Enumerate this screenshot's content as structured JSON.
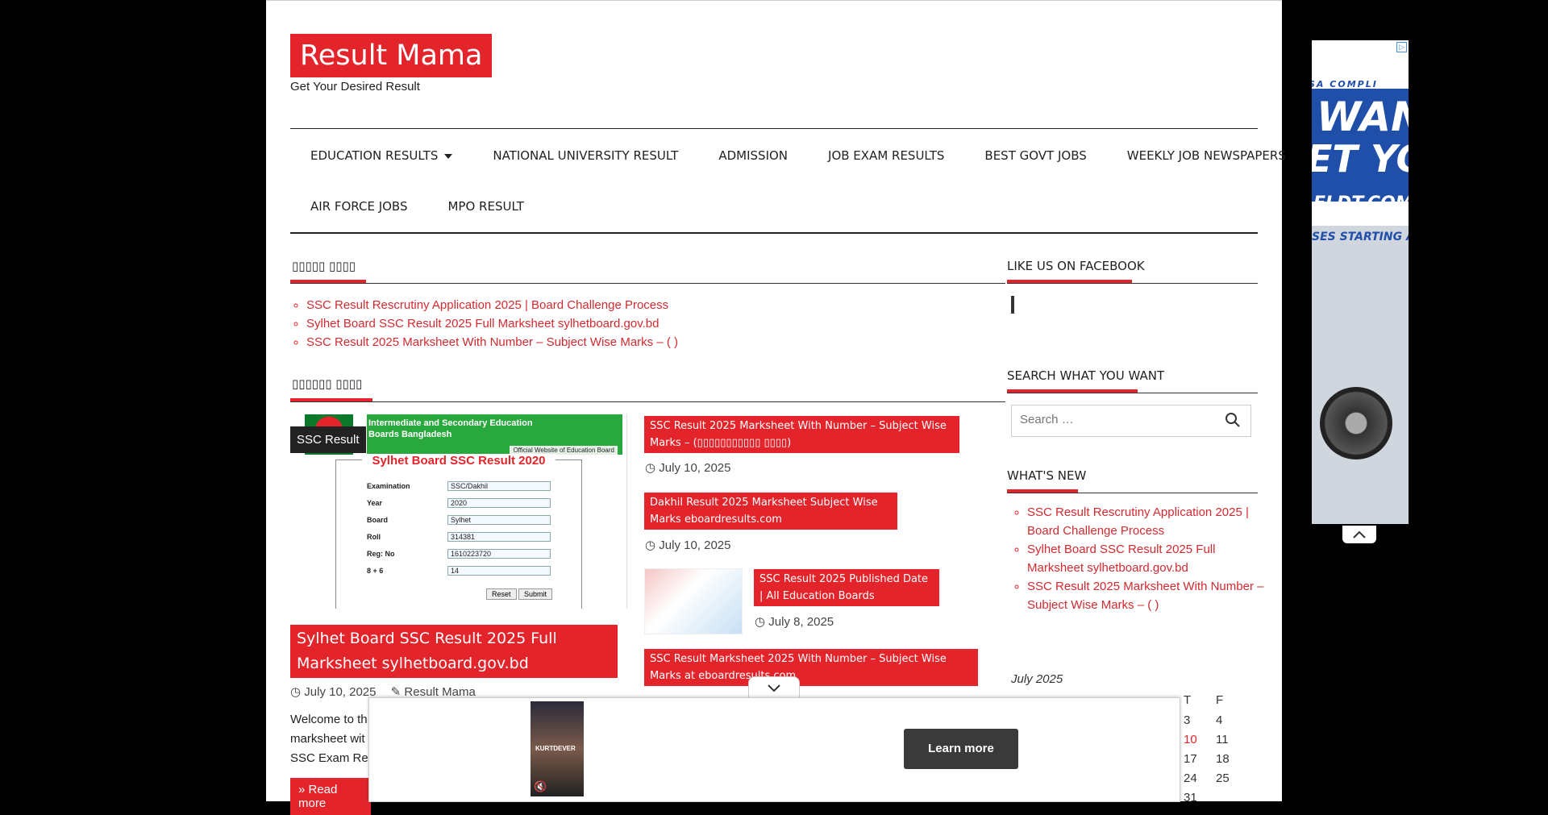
{
  "site": {
    "title": "Result Mama",
    "tagline": "Get Your Desired Result"
  },
  "nav": {
    "row1": [
      "EDUCATION RESULTS",
      "NATIONAL UNIVERSITY RESULT",
      "ADMISSION",
      "JOB EXAM RESULTS",
      "BEST GOVT JOBS",
      "WEEKLY JOB NEWSPAPERS"
    ],
    "row2": [
      "AIR FORCE JOBS",
      "MPO RESULT"
    ]
  },
  "latest": {
    "title": "▯▯▯▯▯ ▯▯▯▯",
    "items": [
      "SSC Result Rescrutiny Application 2025 | Board Challenge Process",
      "Sylhet Board SSC Result 2025 Full Marksheet sylhetboard.gov.bd",
      "SSC Result 2025 Marksheet With Number – Subject Wise Marks – (                    )"
    ]
  },
  "featured_section": {
    "title": "▯▯▯▯▯▯ ▯▯▯▯",
    "category": "SSC Result",
    "image": {
      "header": "Intermediate and Secondary Education Boards Bangladesh",
      "subheader": "Official Website of Education Board",
      "form_title": "Sylhet Board SSC Result 2020",
      "rows": [
        {
          "label": "Examination",
          "value": "SSC/Dakhil"
        },
        {
          "label": "Year",
          "value": "2020"
        },
        {
          "label": "Board",
          "value": "Sylhet"
        },
        {
          "label": "Roll",
          "value": "314381"
        },
        {
          "label": "Reg: No",
          "value": "1610223720"
        },
        {
          "label": "8 + 6",
          "value": "14"
        }
      ],
      "reset": "Reset",
      "submit": "Submit"
    },
    "post_title": "Sylhet Board SSC Result 2025 Full Marksheet sylhetboard.gov.bd",
    "date": "July 10, 2025",
    "author": "Result Mama",
    "excerpt": "Welcome to th marksheet wit SSC Exam Res",
    "read_more": "» Read more"
  },
  "side_posts": [
    {
      "title": "SSC Result 2025 Marksheet With Number – Subject Wise Marks – (▯▯▯▯▯▯▯▯▯▯▯ ▯▯▯▯)",
      "date": "July 10, 2025"
    },
    {
      "title": "Dakhil Result 2025 Marksheet Subject Wise Marks eboardresults.com",
      "date": "July 10, 2025"
    },
    {
      "title": "SSC Result 2025 Published Date | All Education Boards",
      "date": "July 8, 2025"
    },
    {
      "title": "SSC Result Marksheet 2025 With Number – Subject Wise Marks at eboardresults.com",
      "date": ""
    }
  ],
  "sidebar": {
    "facebook_title": "LIKE US ON FACEBOOK",
    "search_title": "SEARCH WHAT YOU WANT",
    "search_placeholder": "Search …",
    "whats_new_title": "WHAT'S NEW",
    "whats_new": [
      "SSC Result Rescrutiny Application 2025 | Board Challenge Process",
      "Sylhet Board SSC Result 2025 Full Marksheet sylhetboard.gov.bd",
      "SSC Result 2025 Marksheet With Number – Subject Wise Marks – (            )"
    ],
    "calendar": {
      "caption": "July 2025",
      "headers": [
        "T",
        "F"
      ],
      "rows": [
        [
          "3",
          "4"
        ],
        [
          "10",
          "11"
        ],
        [
          "17",
          "18"
        ],
        [
          "24",
          "25"
        ],
        [
          "31",
          ""
        ]
      ]
    }
  },
  "right_ad": {
    "line1": "SA COMPLI",
    "line2": "WANT",
    "line3": "ET YOUR",
    "line4": "ELDT.COM",
    "line5": "SES STARTING A"
  },
  "bottom_ad": {
    "cta": "Learn more",
    "thumb_text": "KURTDEVER"
  },
  "colors": {
    "accent": "#e3242b",
    "nav_text": "#222222"
  }
}
